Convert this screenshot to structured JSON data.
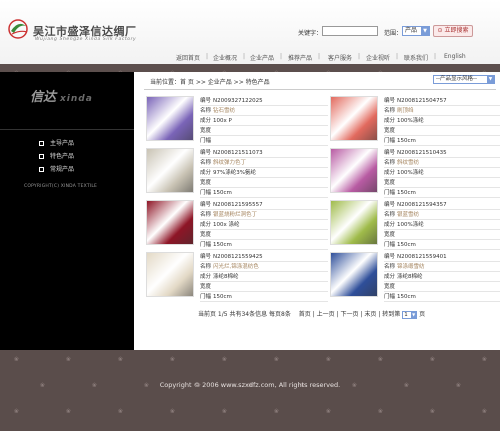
{
  "header": {
    "logo_cn": "吴江市盛泽信达绸厂",
    "logo_en": "Wujiang Shengze Xinda Silk Factory",
    "search_label": "关键字：",
    "search_value": "",
    "range_label": "范围：",
    "range_value": "产品",
    "search_button": "立即搜索"
  },
  "nav": [
    "返回首页",
    "企业概况",
    "企业产品",
    "推荐产品",
    "客户服务",
    "企业视听",
    "联系我们",
    "English"
  ],
  "sidebar": {
    "logo_cn": "信达",
    "logo_en": "xinda",
    "items": [
      "主导产品",
      "特色产品",
      "常规产品"
    ],
    "copyright": "COPYRIGHT(C) XINDA TEXTILE"
  },
  "content": {
    "breadcrumb": "当前位置：首 页 >> 企业产品 >> 特色产品",
    "display_select": "--产品显示风格--",
    "labels": {
      "code": "编号",
      "name": "名称",
      "comp": "成分",
      "width": "宽度",
      "door": "门幅"
    },
    "products": [
      {
        "code": "N2009327122025",
        "name": "钻石雪纺",
        "comp": "100x P",
        "width": "",
        "door": "",
        "color": "#7a64b8"
      },
      {
        "code": "N2008121504757",
        "name": "刷顶绉",
        "comp": "100%涤纶",
        "width": "",
        "door": "150cm",
        "color": "#e26a5e"
      },
      {
        "code": "N2008121511073",
        "name": "斜纹弹力色丁",
        "comp": "97%涤纶3%氨纶",
        "width": "",
        "door": "150cm",
        "color": "#c9c3b4"
      },
      {
        "code": "N2008121510435",
        "name": "斜纹雪纺",
        "comp": "100%涤纶",
        "width": "",
        "door": "150cm",
        "color": "#b85ba3"
      },
      {
        "code": "N2008121595557",
        "name": "银蓝烧粉烂洞色丁",
        "comp": "100x 涤纶",
        "width": "",
        "door": "150cm",
        "color": "#8e1526"
      },
      {
        "code": "N2008121594357",
        "name": "银蓝雪纺",
        "comp": "100%涤纶",
        "width": "",
        "door": "150cm",
        "color": "#9fbb4a"
      },
      {
        "code": "N2008121559425",
        "name": "闪光烂,锦涤混纺色",
        "comp": "涤纶8棉纶",
        "width": "",
        "door": "150cm",
        "color": "#e3d9c6"
      },
      {
        "code": "N2008121559401",
        "name": "锦涤缎雪纺",
        "comp": "涤纶8棉纶",
        "width": "",
        "door": "150cm",
        "color": "#2f4f9a"
      }
    ],
    "pager": {
      "info": "当前页 1/5  共有34条信息  每页8条",
      "first": "首页",
      "prev": "上一页",
      "next": "下一页",
      "last": "末页",
      "jump_label": "转到第",
      "page": "1",
      "page_suffix": "页"
    }
  },
  "footer": {
    "copyright": "Copyright © 2006 www.szxdfz.com, All rights reserved."
  }
}
